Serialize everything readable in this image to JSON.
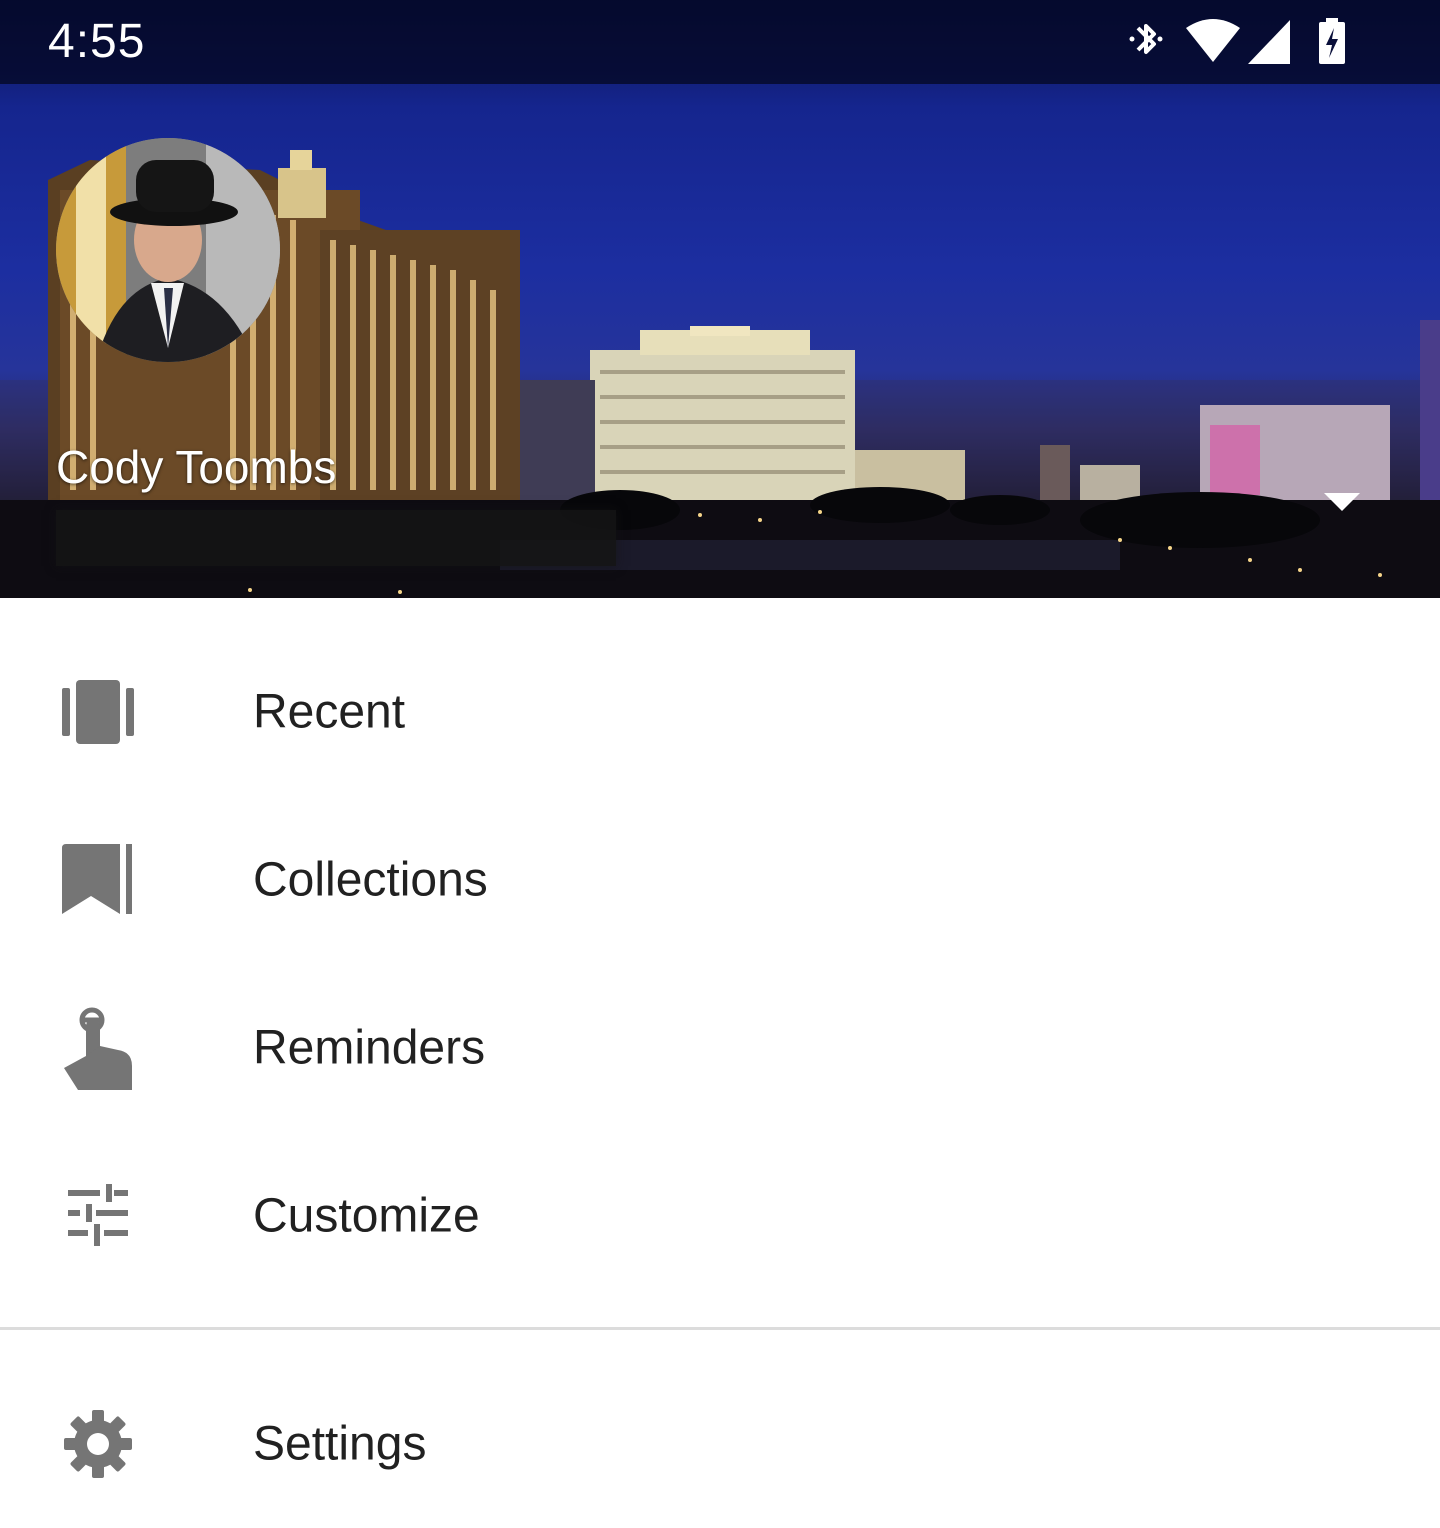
{
  "status_bar": {
    "time": "4:55",
    "icons": [
      "bluetooth-icon",
      "wifi-icon",
      "cell-signal-icon",
      "battery-charging-icon"
    ]
  },
  "header": {
    "user_name": "Cody Toombs",
    "user_email": "",
    "avatar_icon": "avatar",
    "toggle_icon": "dropdown-arrow-icon"
  },
  "menu": {
    "items": [
      {
        "label": "Recent",
        "icon": "recent-icon"
      },
      {
        "label": "Collections",
        "icon": "bookmark-icon"
      },
      {
        "label": "Reminders",
        "icon": "reminder-finger-icon"
      },
      {
        "label": "Customize",
        "icon": "tune-sliders-icon"
      }
    ],
    "settings": {
      "label": "Settings",
      "icon": "gear-icon"
    }
  },
  "colors": {
    "icon_gray": "#757575",
    "text_primary": "#212121",
    "divider": "#dcdcdc",
    "sky_top": "#0b1350",
    "sky_mid": "#1c2ea0"
  }
}
